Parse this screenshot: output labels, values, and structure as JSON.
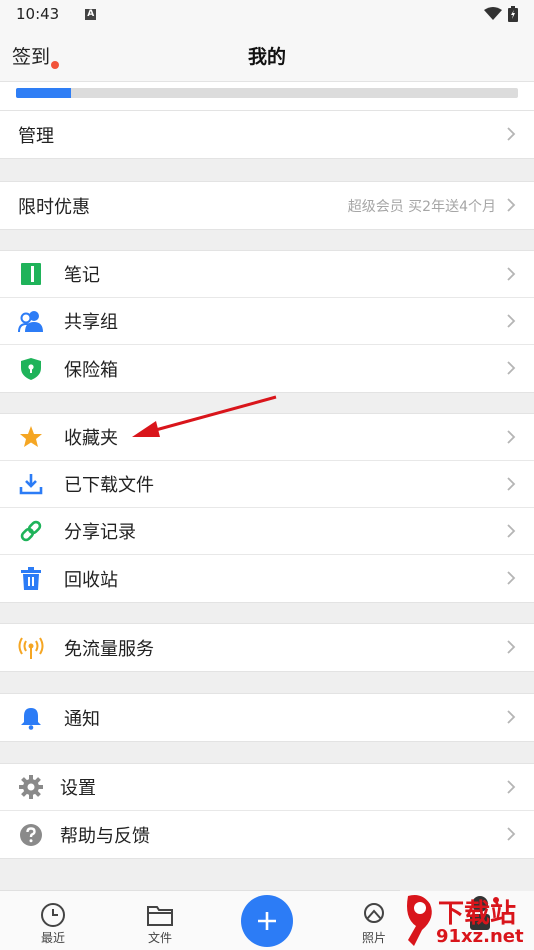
{
  "status_bar": {
    "time": "10:43"
  },
  "header": {
    "sign_in": "签到",
    "title": "我的"
  },
  "storage": {
    "fill_fraction": 0.11
  },
  "group_manage": {
    "label": "管理"
  },
  "group_offer": {
    "label": "限时优惠",
    "extra": "超级会员 买2年送4个月"
  },
  "group_tools": [
    {
      "label": "笔记",
      "icon": "notebook-icon"
    },
    {
      "label": "共享组",
      "icon": "users-icon"
    },
    {
      "label": "保险箱",
      "icon": "shield-icon"
    }
  ],
  "group_files": [
    {
      "label": "收藏夹",
      "icon": "star-icon"
    },
    {
      "label": "已下载文件",
      "icon": "download-icon"
    },
    {
      "label": "分享记录",
      "icon": "link-icon"
    },
    {
      "label": "回收站",
      "icon": "trash-icon"
    }
  ],
  "group_data": {
    "label": "免流量服务",
    "icon": "signal-icon"
  },
  "group_notify": {
    "label": "通知",
    "icon": "bell-icon"
  },
  "group_settings": [
    {
      "label": "设置",
      "icon": "gear-icon"
    },
    {
      "label": "帮助与反馈",
      "icon": "help-icon"
    }
  ],
  "bottom_nav": {
    "recent": "最近",
    "files": "文件",
    "photos": "照片"
  },
  "watermark": {
    "brand": "下载站",
    "domain": "91xz.net"
  },
  "colors": {
    "accent": "#2c7cf6",
    "green": "#1fb35a",
    "orange": "#f5a623",
    "notify_dot": "#f2533a",
    "annotation_arrow": "#d9151b"
  }
}
